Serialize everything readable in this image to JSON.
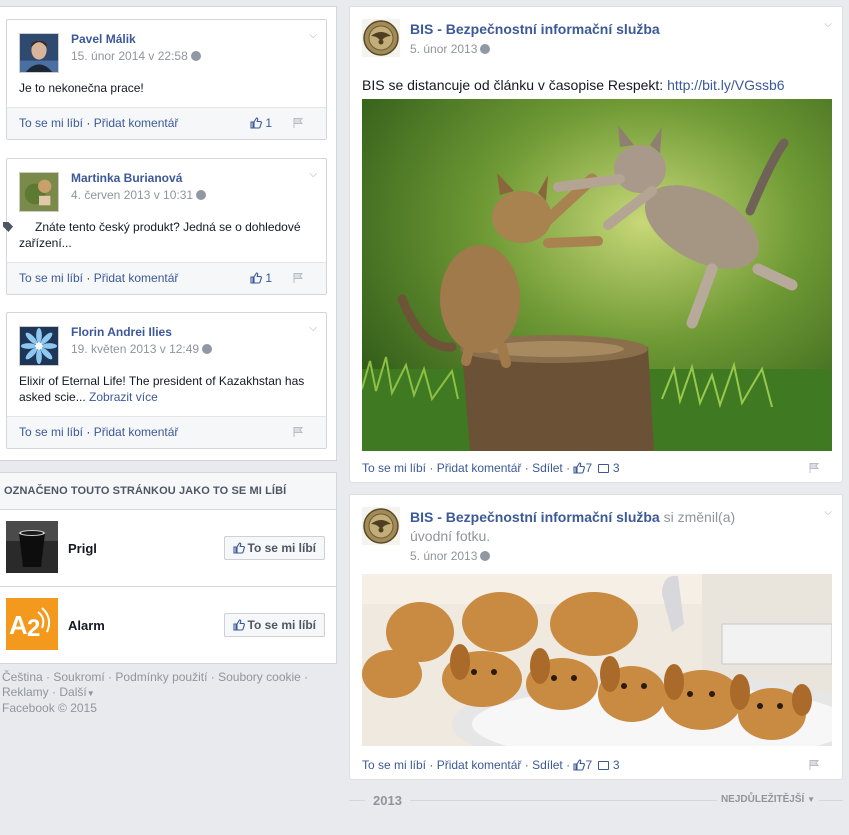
{
  "feed_posts": [
    {
      "author": "Pavel Málik",
      "date": "15. únor 2014 v 22:58",
      "text": "Je to nekonečna prace!",
      "like": "To se mi líbí",
      "comment": "Přidat komentář",
      "likes": "1"
    },
    {
      "author": "Martinka Burianová",
      "date": "4. červen 2013 v 10:31",
      "text": "Znáte tento český produkt? Jedná se o dohledové zařízení...",
      "like": "To se mi líbí",
      "comment": "Přidat komentář",
      "likes": "1"
    },
    {
      "author": "Florin Andrei Ilies",
      "date": "19. květen 2013 v 12:49",
      "text": "Elixir of Eternal Life! The president of Kazakhstan has asked scie...",
      "more": "Zobrazit více",
      "like": "To se mi líbí",
      "comment": "Přidat komentář"
    }
  ],
  "liked_pages": {
    "header": "OZNAČENO TOUTO STRÁNKOU JAKO TO SE MI LÍBÍ",
    "items": [
      {
        "name": "Prigl",
        "button": "To se mi líbí"
      },
      {
        "name": "Alarm",
        "button": "To se mi líbí"
      }
    ]
  },
  "footer_links": {
    "cestina": "Čeština",
    "soukromi": "Soukromí",
    "podminky": "Podmínky použití",
    "cookies": "Soubory cookie",
    "reklamy": "Reklamy",
    "dalsi": "Další",
    "copyright": "Facebook © 2015"
  },
  "timeline_posts": [
    {
      "page": "BIS - Bezpečnostní informační služba",
      "date": "5. únor 2013",
      "text": "BIS se distancuje od článku v časopise Respekt: ",
      "url": "http://bit.ly/VGssb6",
      "like": "To se mi líbí",
      "comment": "Přidat komentář",
      "share": "Sdílet",
      "likes": "7",
      "comments": "3"
    },
    {
      "page": "BIS - Bezpečnostní informační služba",
      "action": "si změnil(a) úvodní fotku.",
      "date": "5. únor 2013",
      "like": "To se mi líbí",
      "comment": "Přidat komentář",
      "share": "Sdílet",
      "likes": "7",
      "comments": "3"
    }
  ],
  "year_bar": {
    "year": "2013",
    "sort": "NEJDŮLEŽITĚJŠÍ"
  },
  "colors": {
    "link": "#3b5998",
    "muted": "#90949c",
    "background": "#e9eaed"
  }
}
